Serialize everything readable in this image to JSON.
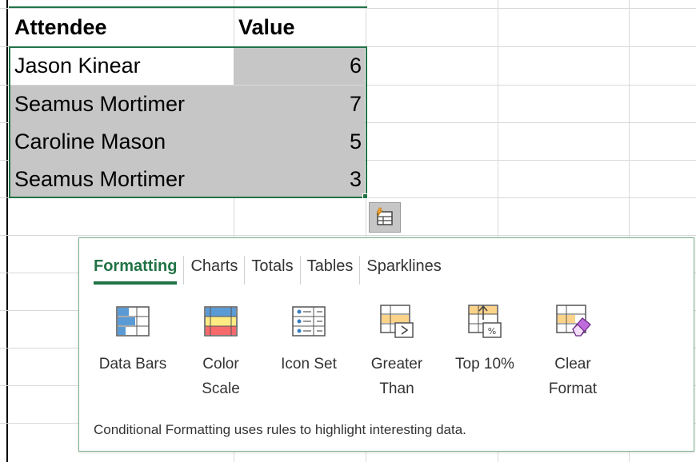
{
  "sheet": {
    "headers": {
      "name": "Attendee",
      "value": "Value"
    },
    "rows": [
      {
        "name": "Jason Kinear",
        "value": "6"
      },
      {
        "name": "Seamus Mortimer",
        "value": "7"
      },
      {
        "name": "Caroline Mason",
        "value": "5"
      },
      {
        "name": "Seamus Mortimer",
        "value": "3"
      }
    ]
  },
  "quick_analysis": {
    "tabs": [
      {
        "label": "Formatting",
        "active": true
      },
      {
        "label": "Charts",
        "active": false
      },
      {
        "label": "Totals",
        "active": false
      },
      {
        "label": "Tables",
        "active": false
      },
      {
        "label": "Sparklines",
        "active": false
      }
    ],
    "options": [
      {
        "label": "Data Bars",
        "icon": "data-bars-icon"
      },
      {
        "label": "Color\nScale",
        "icon": "color-scale-icon"
      },
      {
        "label": "Icon Set",
        "icon": "icon-set-icon"
      },
      {
        "label": "Greater\nThan",
        "icon": "greater-than-icon"
      },
      {
        "label": "Top 10%",
        "icon": "top-10-percent-icon"
      },
      {
        "label": "Clear\nFormat",
        "icon": "clear-format-icon"
      }
    ],
    "description": "Conditional Formatting uses rules to highlight interesting data."
  },
  "colors": {
    "accent": "#217346",
    "selection_fill": "#c6c6c6",
    "bar_blue": "#5b9bd5",
    "scale_red": "#f8696b",
    "scale_yellow": "#ffeb84",
    "highlight_orange": "#fdd38a",
    "eraser_purple": "#c06bdc"
  }
}
